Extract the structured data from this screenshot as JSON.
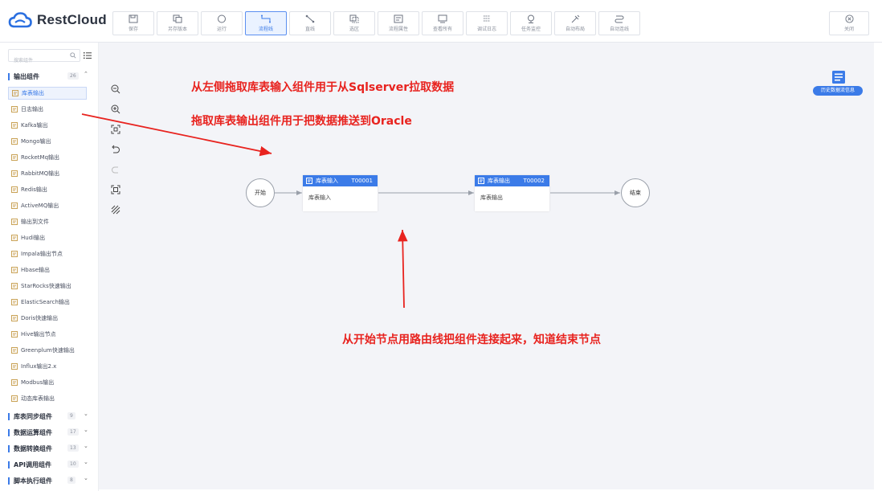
{
  "app": {
    "brand": "RestCloud"
  },
  "toolbar": {
    "buttons": [
      {
        "label": "保存",
        "icon": "save-icon"
      },
      {
        "label": "另存版本",
        "icon": "copy-icon"
      },
      {
        "label": "运行",
        "icon": "run-icon"
      },
      {
        "label": "流程线",
        "icon": "flow-line-icon",
        "active": true
      },
      {
        "label": "直线",
        "icon": "straight-line-icon"
      },
      {
        "label": "选区",
        "icon": "select-area-icon"
      },
      {
        "label": "流程属性",
        "icon": "properties-icon"
      },
      {
        "label": "查看所有",
        "icon": "view-all-icon"
      },
      {
        "label": "调试日志",
        "icon": "debug-log-icon"
      },
      {
        "label": "任务监控",
        "icon": "monitor-icon"
      },
      {
        "label": "自动布局",
        "icon": "auto-layout-icon"
      },
      {
        "label": "自动连线",
        "icon": "auto-connect-icon"
      }
    ],
    "close_label": "关闭"
  },
  "sidebar": {
    "search_placeholder": "搜索组件",
    "open_group": {
      "label": "输出组件",
      "count": "26"
    },
    "items": [
      "库表输出",
      "日志输出",
      "Kafka输出",
      "Mongo输出",
      "RocketMq输出",
      "RabbitMQ输出",
      "Redis输出",
      "ActiveMQ输出",
      "输出到文件",
      "Hudi输出",
      "Impala输出节点",
      "Hbase输出",
      "StarRocks快速输出",
      "ElasticSearch输出",
      "Doris快速输出",
      "Hive输出节点",
      "Greenplum快速输出",
      "Influx输出2.x",
      "Modbus输出",
      "动态库表输出"
    ],
    "groups": [
      {
        "label": "库表同步组件",
        "count": "9"
      },
      {
        "label": "数据运算组件",
        "count": "17"
      },
      {
        "label": "数据转换组件",
        "count": "13"
      },
      {
        "label": "API调用组件",
        "count": "10"
      },
      {
        "label": "脚本执行组件",
        "count": "8"
      }
    ]
  },
  "canvas": {
    "annotations": [
      "从左侧拖取库表输入组件用于从Sqlserver拉取数据",
      "拖取库表输出组件用于把数据推送到Oracle",
      "从开始节点用路由线把组件连接起来，知道结束节点"
    ],
    "start_label": "开始",
    "end_label": "结束",
    "nodes": [
      {
        "title": "库表输入",
        "id": "T00001",
        "body": "库表输入"
      },
      {
        "title": "库表输出",
        "id": "T00002",
        "body": "库表输出"
      }
    ],
    "history_label": "历史数据流信息"
  },
  "colors": {
    "accent": "#3b7be8",
    "annotation": "#e8231f",
    "canvas_bg": "#f3f4f8"
  }
}
